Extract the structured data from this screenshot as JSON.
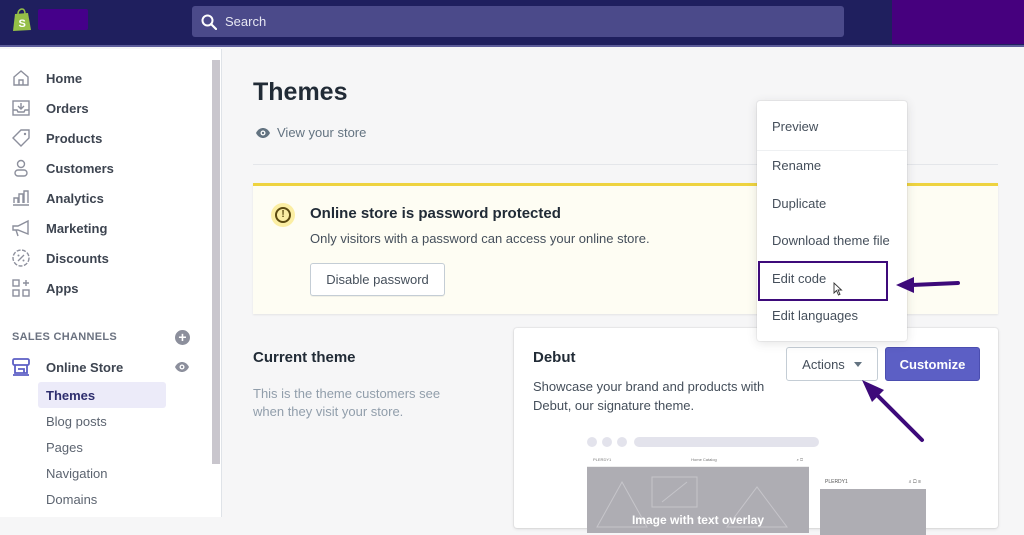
{
  "topbar": {
    "logo_icon": "shopify-bag-icon",
    "search_icon": "search-icon",
    "search_placeholder": "Search",
    "colors": {
      "bar": "#1f1f5e",
      "search": "#4b4a8a",
      "redaction": "#46007e"
    }
  },
  "sidebar": {
    "items": [
      {
        "label": "Home",
        "icon": "home-icon"
      },
      {
        "label": "Orders",
        "icon": "orders-inbox-icon"
      },
      {
        "label": "Products",
        "icon": "tag-icon"
      },
      {
        "label": "Customers",
        "icon": "person-icon"
      },
      {
        "label": "Analytics",
        "icon": "bar-chart-icon"
      },
      {
        "label": "Marketing",
        "icon": "megaphone-icon"
      },
      {
        "label": "Discounts",
        "icon": "discount-badge-icon"
      },
      {
        "label": "Apps",
        "icon": "apps-grid-icon"
      }
    ],
    "sales_channels": {
      "title": "SALES CHANNELS",
      "add_icon": "plus-circle-icon",
      "online_store": {
        "label": "Online Store",
        "icon": "storefront-icon",
        "view_icon": "eye-icon",
        "subitems": [
          {
            "label": "Themes",
            "active": true
          },
          {
            "label": "Blog posts",
            "active": false
          },
          {
            "label": "Pages",
            "active": false
          },
          {
            "label": "Navigation",
            "active": false
          },
          {
            "label": "Domains",
            "active": false
          }
        ]
      }
    }
  },
  "main": {
    "title": "Themes",
    "view_store": "View your store",
    "banner": {
      "title": "Online store is password protected",
      "text": "Only visitors with a password can access your online store.",
      "button": "Disable password",
      "color": "#eed33f"
    },
    "current_theme": {
      "title": "Current theme",
      "description": "This is the theme customers see when they visit your store."
    },
    "theme_card": {
      "name": "Debut",
      "description": "Showcase your brand and products with Debut, our signature theme.",
      "actions_label": "Actions",
      "customize_label": "Customize",
      "accent": "#5c5fc5",
      "preview": {
        "desktop_brand": "PLERDY1",
        "desktop_links": "Home  Catalog",
        "hero_text": "Image with text overlay",
        "mobile_brand": "PLERDY1"
      }
    }
  },
  "actions_menu": {
    "items": [
      {
        "label": "Preview"
      },
      {
        "label": "Rename"
      },
      {
        "label": "Duplicate"
      },
      {
        "label": "Download theme file"
      },
      {
        "label": "Edit code",
        "highlighted": true
      },
      {
        "label": "Edit languages"
      }
    ]
  },
  "annotations": {
    "arrow_color": "#3d0a7a",
    "arrows": [
      "points-to-edit-code",
      "points-to-actions-button"
    ]
  }
}
